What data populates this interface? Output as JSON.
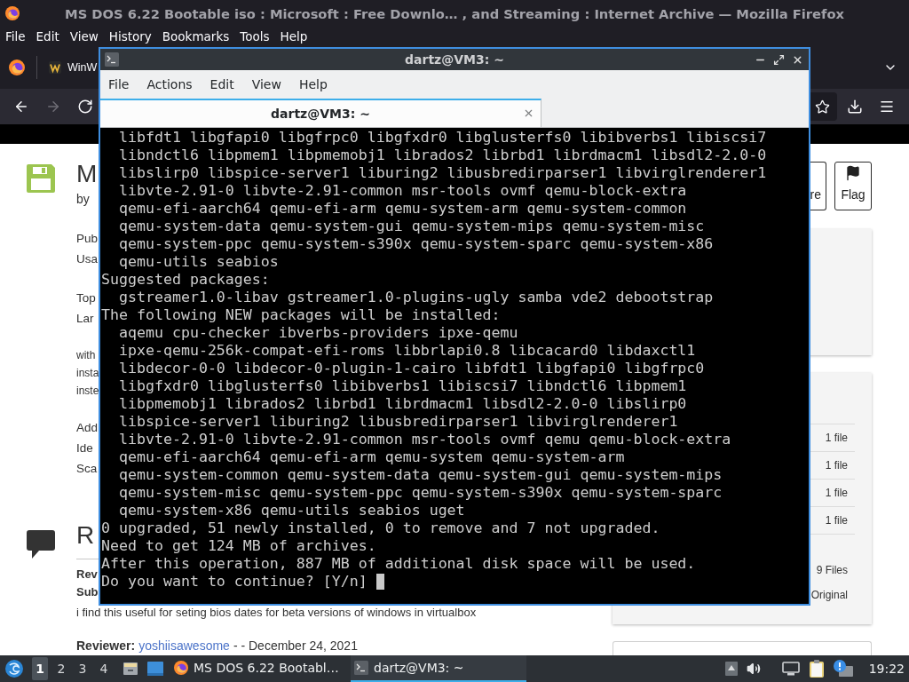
{
  "browser": {
    "title": "MS DOS 6.22 Bootable iso : Microsoft : Free Downlo… , and Streaming : Internet Archive — Mozilla Firefox",
    "menu": [
      "File",
      "Edit",
      "View",
      "History",
      "Bookmarks",
      "Tools",
      "Help"
    ],
    "tabs": [
      {
        "label": "WinW",
        "selected": false
      }
    ],
    "nav_buttons": [
      {
        "kind": "back",
        "disabled": false
      },
      {
        "kind": "forward",
        "disabled": true
      },
      {
        "kind": "reload",
        "disabled": false
      }
    ]
  },
  "page": {
    "title": "M",
    "byline": "by",
    "metadata_groups": [
      {
        "lines": [
          "Pub",
          "Usa"
        ]
      },
      {
        "lines": [
          "Top",
          "Lar"
        ]
      }
    ],
    "description": [
      "with",
      "insta",
      "inste"
    ],
    "identifiers": [
      "Add",
      "Ide",
      "Sca"
    ],
    "reviews_heading": "R",
    "review_fields": [
      "Rev",
      "Sub"
    ],
    "review_body": "i find this useful for seting bios dates for beta versions of windows in virtualbox",
    "reviewer_label": "Reviewer:",
    "reviewer_name": "yoshiisawesome",
    "review_date": "- - December 24, 2021",
    "actions": [
      {
        "label": "re",
        "kind": "share"
      },
      {
        "label": "Flag",
        "kind": "flag"
      }
    ],
    "file_rows": [
      "1 file",
      "1 file",
      "1 file",
      "1 file"
    ],
    "files_total": "9 Files",
    "original_label": "Original"
  },
  "terminal": {
    "title": "dartz@VM3: ~",
    "menu": [
      "File",
      "Actions",
      "Edit",
      "View",
      "Help"
    ],
    "tabs": [
      {
        "label": "dartz@VM3: ~",
        "selected": true
      }
    ],
    "lines": [
      "  libfdt1 libgfapi0 libgfrpc0 libgfxdr0 libglusterfs0 libibverbs1 libiscsi7",
      "  libndctl6 libpmem1 libpmemobj1 librados2 librbd1 librdmacm1 libsdl2-2.0-0",
      "  libslirp0 libspice-server1 liburing2 libusbredirparser1 libvirglrenderer1",
      "  libvte-2.91-0 libvte-2.91-common msr-tools ovmf qemu-block-extra",
      "  qemu-efi-aarch64 qemu-efi-arm qemu-system-arm qemu-system-common",
      "  qemu-system-data qemu-system-gui qemu-system-mips qemu-system-misc",
      "  qemu-system-ppc qemu-system-s390x qemu-system-sparc qemu-system-x86",
      "  qemu-utils seabios",
      "Suggested packages:",
      "  gstreamer1.0-libav gstreamer1.0-plugins-ugly samba vde2 debootstrap",
      "The following NEW packages will be installed:",
      "  aqemu cpu-checker ibverbs-providers ipxe-qemu",
      "  ipxe-qemu-256k-compat-efi-roms libbrlapi0.8 libcacard0 libdaxctl1",
      "  libdecor-0-0 libdecor-0-plugin-1-cairo libfdt1 libgfapi0 libgfrpc0",
      "  libgfxdr0 libglusterfs0 libibverbs1 libiscsi7 libndctl6 libpmem1",
      "  libpmemobj1 librados2 librbd1 librdmacm1 libsdl2-2.0-0 libslirp0",
      "  libspice-server1 liburing2 libusbredirparser1 libvirglrenderer1",
      "  libvte-2.91-0 libvte-2.91-common msr-tools ovmf qemu qemu-block-extra",
      "  qemu-efi-aarch64 qemu-efi-arm qemu-system qemu-system-arm",
      "  qemu-system-common qemu-system-data qemu-system-gui qemu-system-mips",
      "  qemu-system-misc qemu-system-ppc qemu-system-s390x qemu-system-sparc",
      "  qemu-system-x86 qemu-utils seabios uget",
      "0 upgraded, 51 newly installed, 0 to remove and 7 not upgraded.",
      "Need to get 124 MB of archives.",
      "After this operation, 887 MB of additional disk space will be used.",
      "Do you want to continue? [Y/n] "
    ],
    "cursor": true
  },
  "taskbar": {
    "desktops": [
      {
        "label": "1",
        "selected": true
      },
      {
        "label": "2",
        "selected": false
      },
      {
        "label": "3",
        "selected": false
      },
      {
        "label": "4",
        "selected": false
      }
    ],
    "tasks": [
      {
        "label": "MS DOS 6.22 Bootabl…",
        "kind": "browser",
        "selected": false
      },
      {
        "label": "dartz@VM3: ~",
        "kind": "terminal",
        "selected": true
      }
    ],
    "clock": "19:22"
  }
}
